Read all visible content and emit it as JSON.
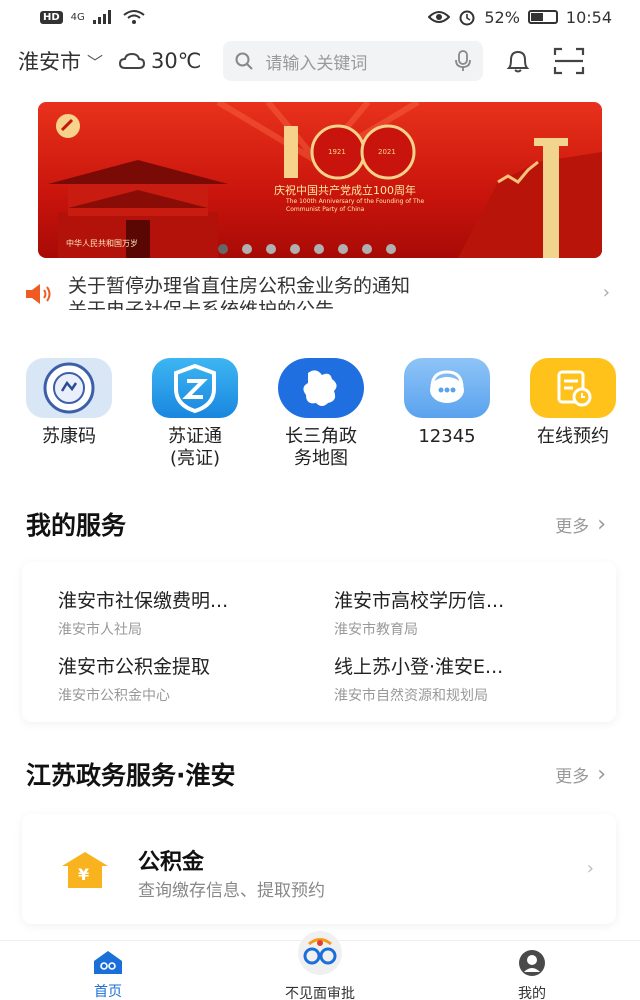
{
  "status_bar": {
    "network_badge": "HD",
    "signal": "4G",
    "battery_text": "52%",
    "battery_level": 0.52,
    "time": "10:54"
  },
  "header": {
    "city": "淮安市",
    "temperature": "30℃",
    "search_placeholder": "请输入关键词"
  },
  "banner": {
    "headline": "庆祝中国共产党成立100周年",
    "headline_en": "The 100th Anniversary of the Founding of The Communist Party of China",
    "number": "100",
    "year_left": "1921",
    "year_right": "2021",
    "gate_text": "中华人民共和国万岁",
    "page_count": 8,
    "active_index": 0
  },
  "notice": {
    "line1": "关于暂停办理省直住房公积金业务的通知",
    "line2": "关于电子社保卡系统维护的公告"
  },
  "shortcuts": [
    {
      "label": "苏康码",
      "icon": "sukang-code-icon"
    },
    {
      "label": "苏证通\n(亮证)",
      "icon": "certificate-shield-icon"
    },
    {
      "label": "长三角政\n务地图",
      "icon": "map-icon"
    },
    {
      "label": "12345",
      "icon": "hotline-headset-icon"
    },
    {
      "label": "在线预约",
      "icon": "appointment-icon"
    }
  ],
  "my_services": {
    "title": "我的服务",
    "more": "更多",
    "items": [
      {
        "name": "淮安市社保缴费明...",
        "dept": "淮安市人社局"
      },
      {
        "name": "淮安市高校学历信...",
        "dept": "淮安市教育局"
      },
      {
        "name": "淮安市公积金提取",
        "dept": "淮安市公积金中心"
      },
      {
        "name": "线上苏小登·淮安E...",
        "dept": "淮安市自然资源和规划局"
      }
    ]
  },
  "gov_services": {
    "title": "江苏政务服务·淮安",
    "more": "更多",
    "card_title": "公积金",
    "card_desc": "查询缴存信息、提取预约",
    "card_icon_text": "¥"
  },
  "bottom_nav": [
    {
      "label": "首页",
      "active": true
    },
    {
      "label": "不见面审批",
      "active": false
    },
    {
      "label": "我的",
      "active": false
    }
  ],
  "colors": {
    "primary_blue": "#1a6fd8",
    "banner_red": "#d81e10",
    "shortcut_yellow": "#ffc21a",
    "gov_icon_yellow": "#f8b31e"
  }
}
